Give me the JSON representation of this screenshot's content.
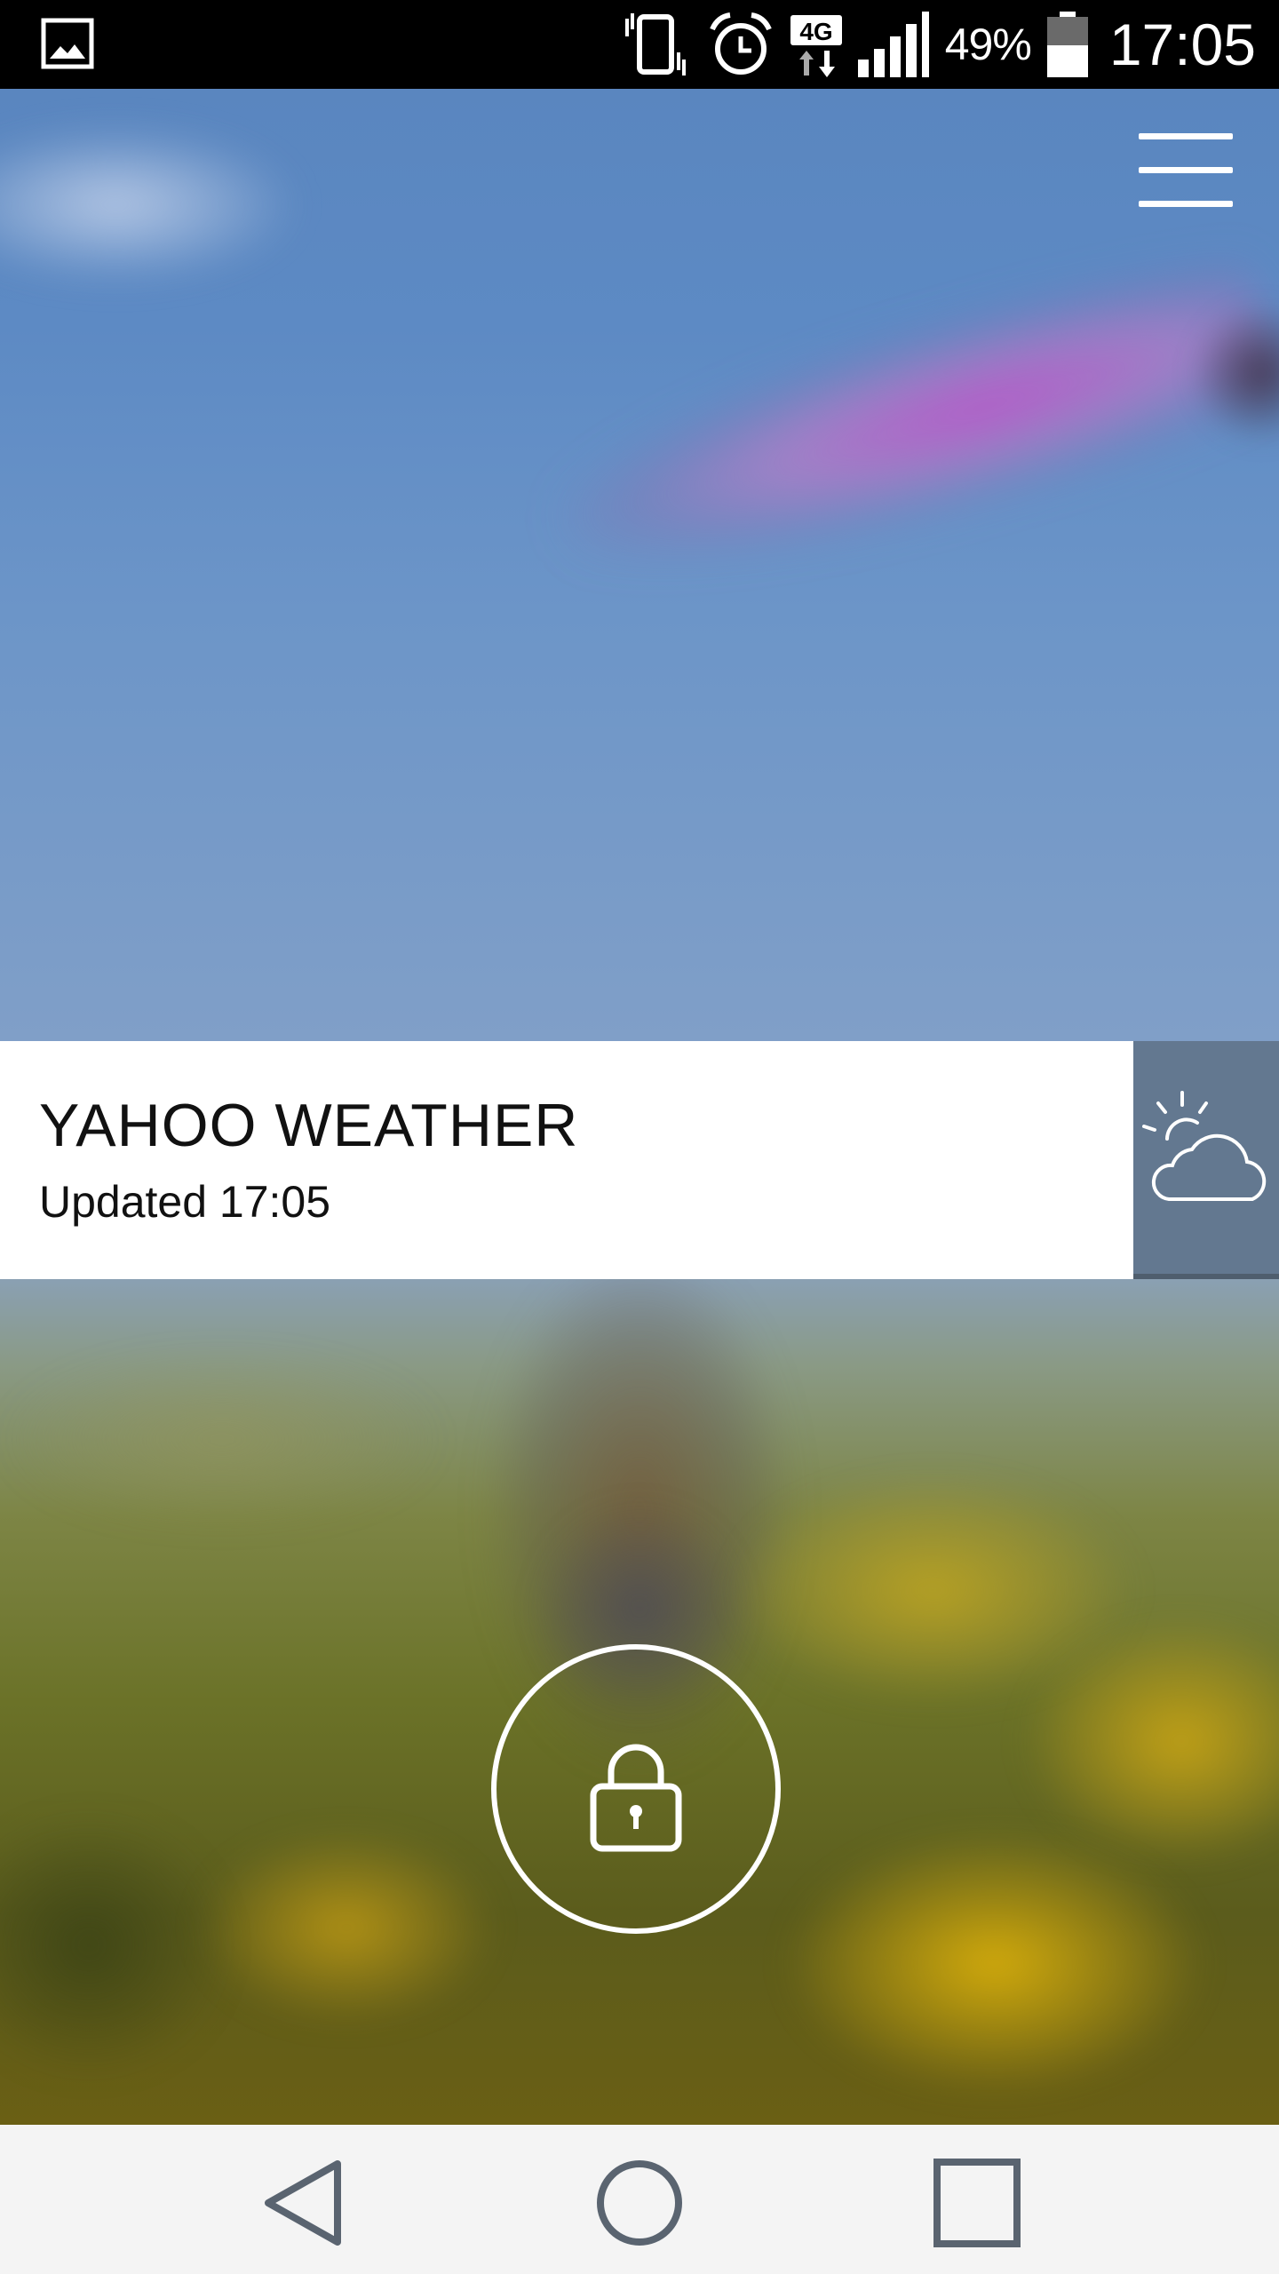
{
  "status_bar": {
    "battery_percent": "49%",
    "time": "17:05",
    "network_type": "4G",
    "icons": [
      "gallery-icon",
      "vibrate-icon",
      "alarm-icon",
      "network-4g-icon",
      "signal-icon",
      "battery-icon"
    ]
  },
  "weather_card": {
    "title": "YAHOO WEATHER",
    "updated": "Updated 17:05",
    "icon": "partly-cloudy-icon"
  },
  "top_menu": {
    "icon": "hamburger-menu-icon"
  },
  "lock": {
    "icon": "padlock-icon"
  },
  "nav_bar": {
    "buttons": [
      "back-icon",
      "home-icon",
      "recents-icon"
    ]
  },
  "colors": {
    "sky": "#6c95c8",
    "card": "#ffffff",
    "weather_tile": "#637890",
    "nav_bar": "#f4f4f4",
    "nav_icons": "#5a6470"
  }
}
